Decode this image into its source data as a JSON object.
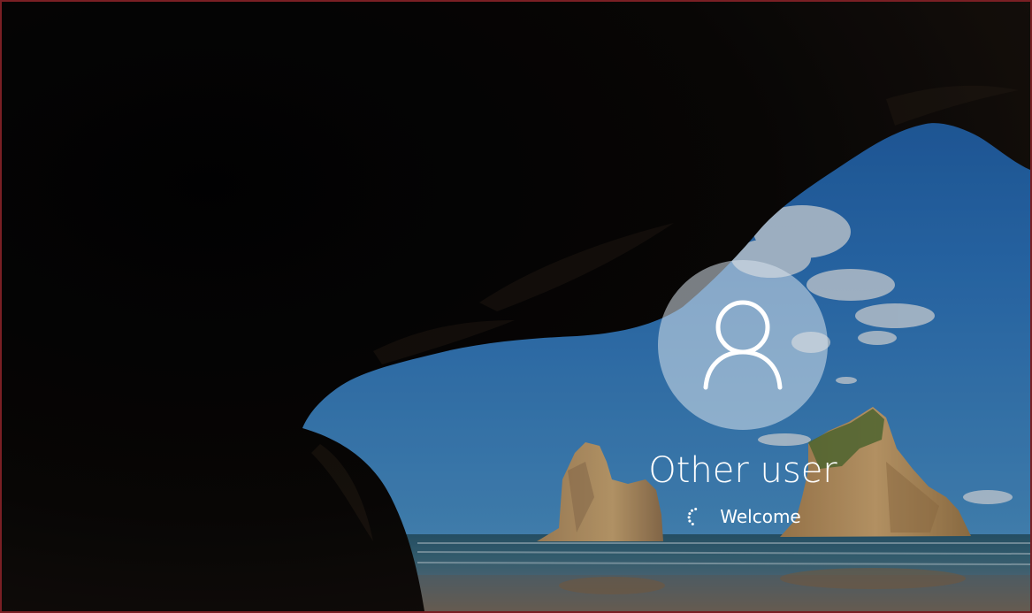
{
  "login": {
    "user_name": "Other user",
    "status_text": "Welcome"
  },
  "icons": {
    "avatar": "user-silhouette-icon",
    "spinner": "loading-dots-icon"
  },
  "colors": {
    "text": "#ffffff",
    "window_border": "#7a1f24",
    "avatar_fill": "#a9b9c9"
  }
}
